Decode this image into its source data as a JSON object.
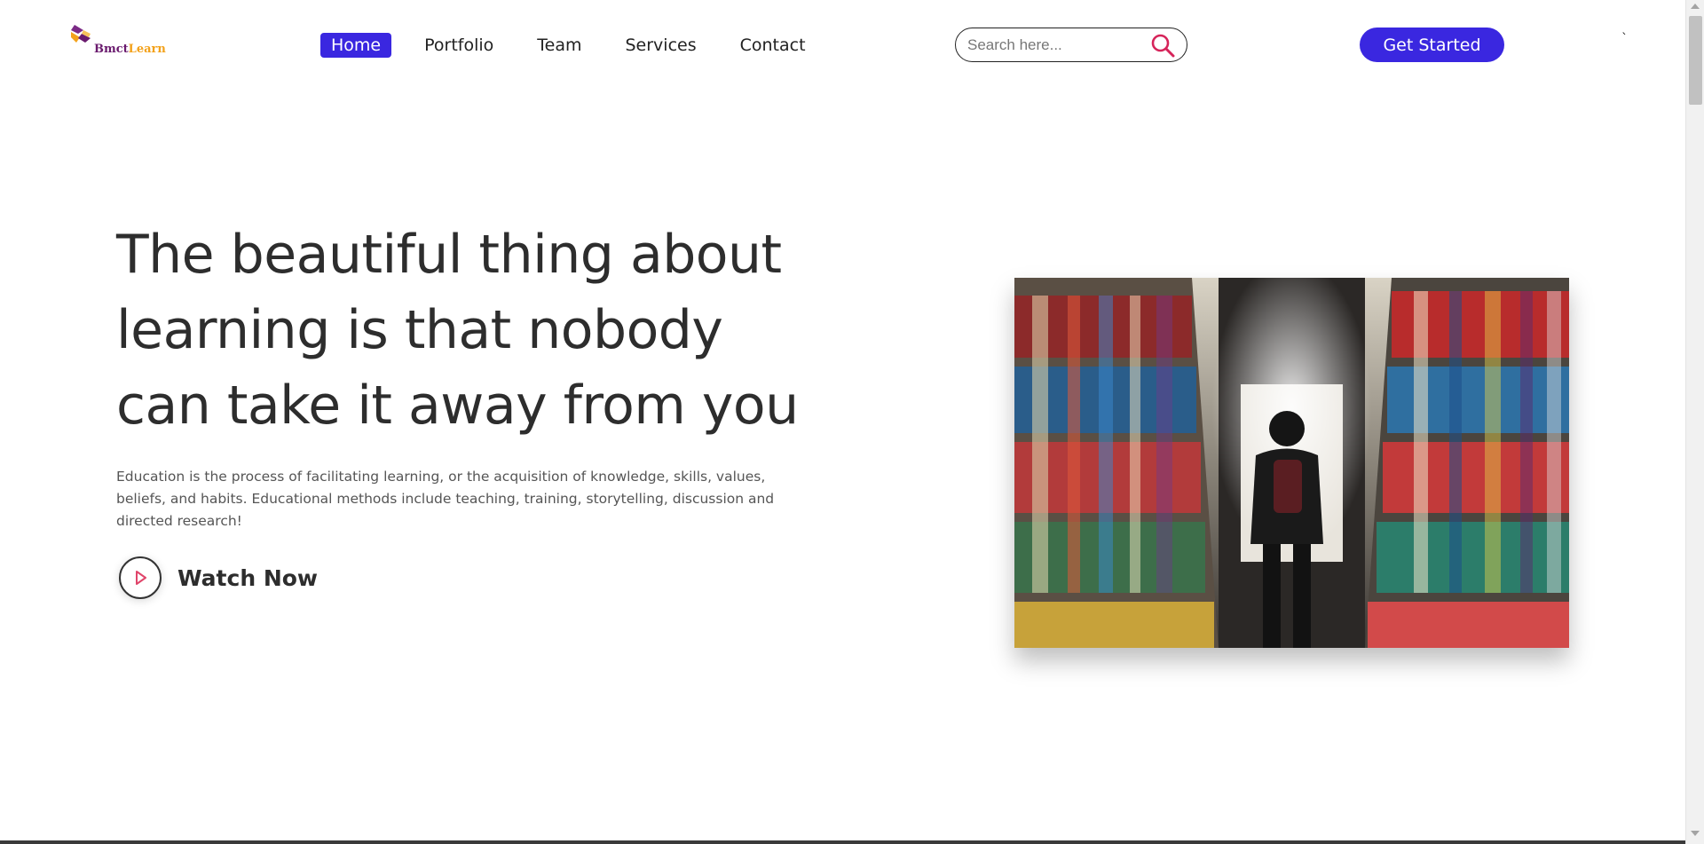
{
  "header": {
    "logo": {
      "brand_part1": "Bmct",
      "brand_part2": "Learn"
    },
    "nav": [
      {
        "label": "Home",
        "active": true
      },
      {
        "label": "Portfolio",
        "active": false
      },
      {
        "label": "Team",
        "active": false
      },
      {
        "label": "Services",
        "active": false
      },
      {
        "label": "Contact",
        "active": false
      }
    ],
    "search": {
      "placeholder": "Search here...",
      "value": ""
    },
    "cta_label": "Get Started",
    "tick_text": "`"
  },
  "hero": {
    "title": "The beautiful thing about learning is that nobody can take it away from you",
    "description": "Education is the process of facilitating learning, or the acquisition of knowledge, skills, values, beliefs, and habits. Educational methods include teaching, training, storytelling, discussion and directed research!",
    "watch_label": "Watch Now"
  },
  "colors": {
    "accent": "#3a27e0",
    "play_icon": "#e0456a",
    "search_icon": "#d6245a",
    "logo_purple": "#6a1b6e",
    "logo_orange": "#f3a21b"
  },
  "icons": {
    "logo": "bmctlearn-logo-icon",
    "search": "search-icon",
    "play": "play-icon"
  }
}
